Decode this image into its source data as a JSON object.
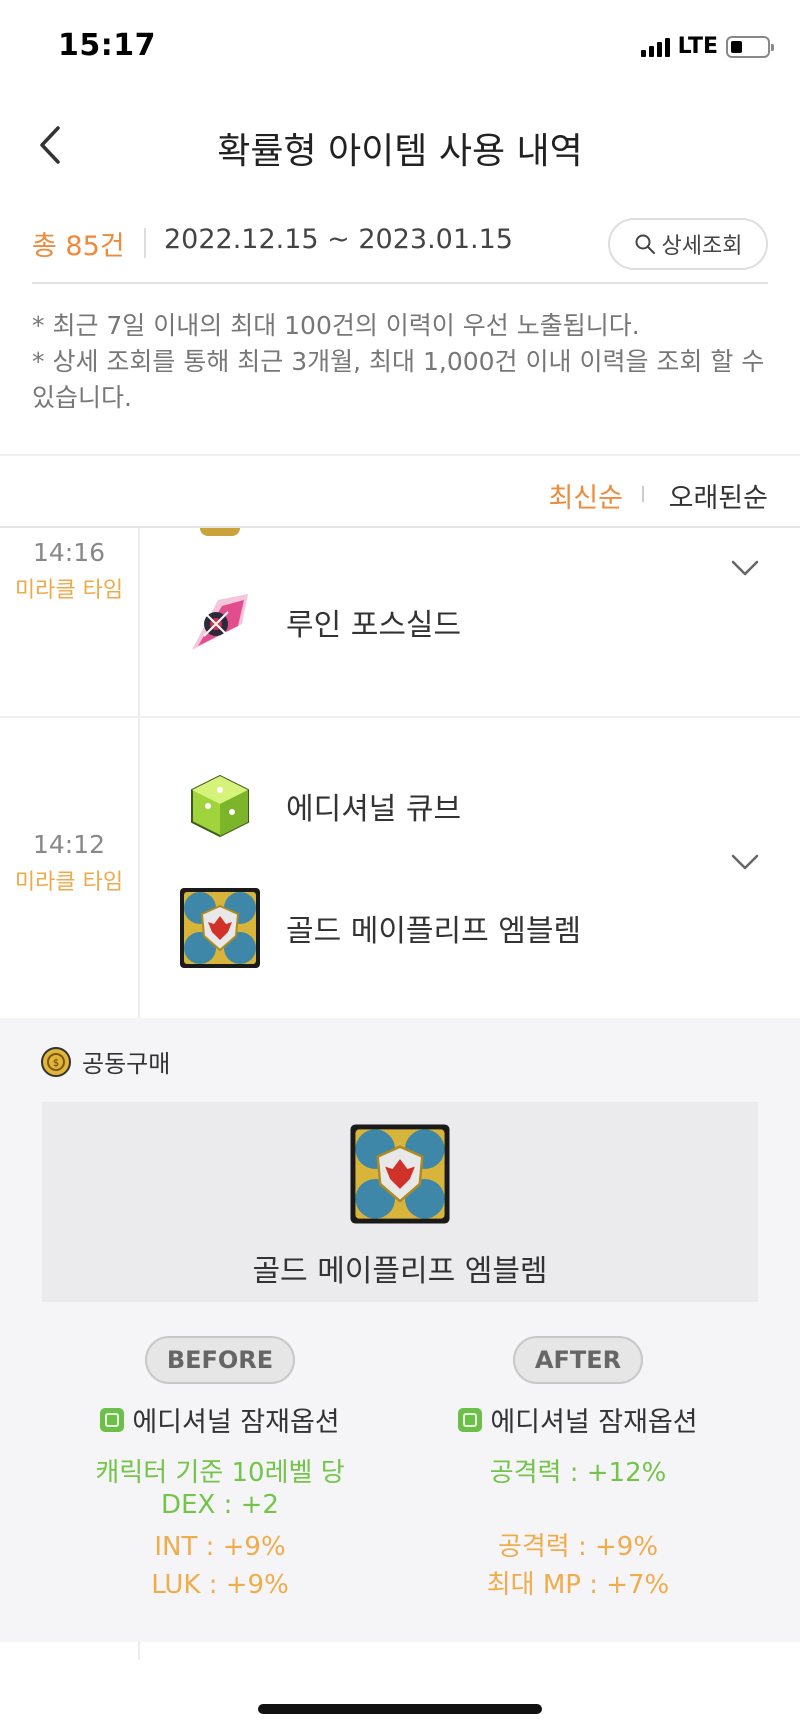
{
  "status_bar": {
    "time": "15:17",
    "network": "LTE"
  },
  "header": {
    "title": "확률형 아이템 사용 내역"
  },
  "summary": {
    "total": "총 85건",
    "date_range": "2022.12.15 ~ 2023.01.15",
    "detail_button": "상세조회"
  },
  "notice": [
    "* 최근 7일 이내의 최대 100건의 이력이 우선 노출됩니다.",
    "* 상세 조회를 통해 최근 3개월, 최대 1,000건 이내 이력을 조회 할 수 있습니다."
  ],
  "sort": {
    "newest": "최신순",
    "oldest": "오래된순"
  },
  "entries": [
    {
      "time": "14:16",
      "label": "미라클 타임",
      "items": [
        "루인 포스실드"
      ]
    },
    {
      "time": "14:12",
      "label": "미라클 타임",
      "items": [
        "에디셔널 큐브",
        "골드 메이플리프 엠블렘"
      ]
    }
  ],
  "detail": {
    "group": "공동구매",
    "item_name": "골드 메이플리프 엠블렘",
    "before": {
      "tag": "BEFORE",
      "option_title": "에디셔널 잠재옵션",
      "lines": [
        "캐릭터 기준 10레벨 당",
        "DEX : +2",
        "INT : +9%",
        "LUK : +9%"
      ]
    },
    "after": {
      "tag": "AFTER",
      "option_title": "에디셔널 잠재옵션",
      "lines": [
        "공격력 : +12%",
        "공격력 : +9%",
        "최대 MP : +7%"
      ]
    }
  },
  "colors": {
    "accent": "#ee8a3c",
    "gold": "#f0a94a",
    "green": "#74c449"
  },
  "icons": {
    "ruin_force_shield": "ruin-force-shield-icon",
    "additional_cube": "additional-cube-icon",
    "gold_maple_emblem": "gold-maple-emblem-icon",
    "coin": "coin-icon"
  }
}
